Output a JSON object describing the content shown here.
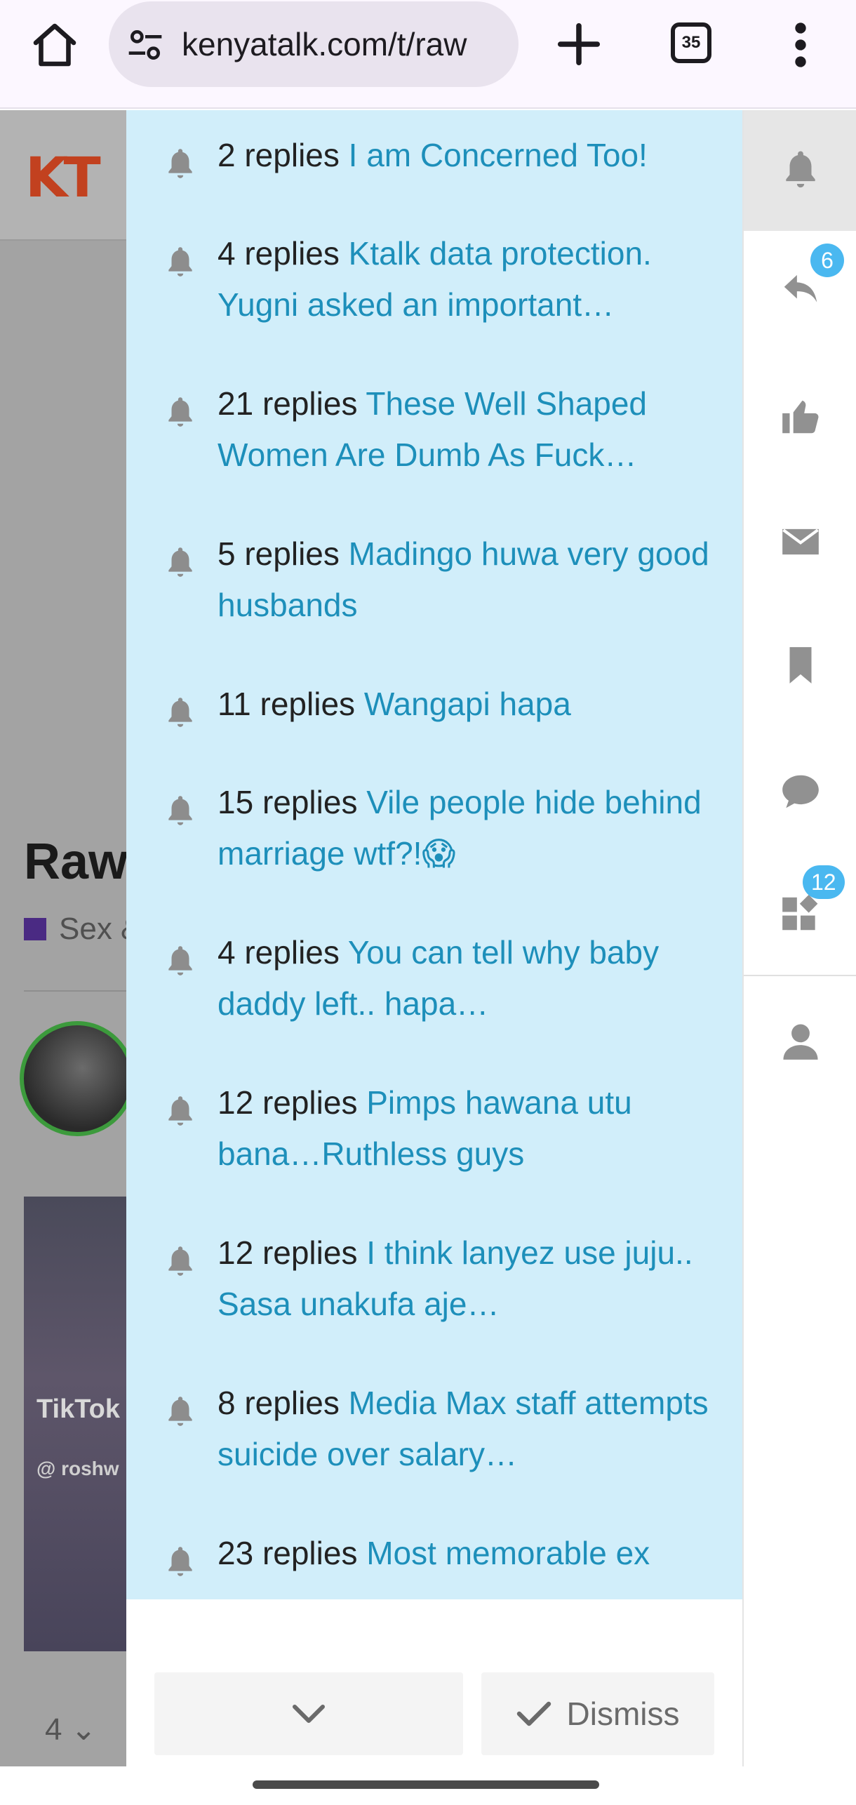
{
  "browser": {
    "url": "kenyatalk.com/t/raw",
    "tab_count": "35"
  },
  "background_page": {
    "logo": "KT",
    "title": "Raw",
    "category": "Sex &",
    "tiktok_watermark": "TikTok",
    "tiktok_handle": "@ roshw",
    "pager_value": "4"
  },
  "side_panel": {
    "replies_badge": "6",
    "review_badge": "12"
  },
  "notifications": [
    {
      "count": "2 replies",
      "topic": "I am Concerned Too!"
    },
    {
      "count": "4 replies",
      "topic": "Ktalk data protection. Yugni asked an important…"
    },
    {
      "count": "21 replies",
      "topic": "These Well Shaped Women Are Dumb As Fuck…"
    },
    {
      "count": "5 replies",
      "topic": "Madingo huwa very good husbands"
    },
    {
      "count": "11 replies",
      "topic": "Wangapi hapa"
    },
    {
      "count": "15 replies",
      "topic": "Vile people hide behind marriage wtf?!😱"
    },
    {
      "count": "4 replies",
      "topic": "You can tell why baby daddy left.. hapa…"
    },
    {
      "count": "12 replies",
      "topic": "Pimps hawana utu bana…Ruthless guys"
    },
    {
      "count": "12 replies",
      "topic": "I think lanyez use juju.. Sasa unakufa aje…"
    },
    {
      "count": "8 replies",
      "topic": "Media Max staff attempts suicide over salary…"
    },
    {
      "count": "23 replies",
      "topic": "Most memorable ex"
    }
  ],
  "footer": {
    "dismiss_label": "Dismiss"
  },
  "colors": {
    "notification_bg": "#d1eefa",
    "topic_link": "#1d8fba",
    "badge": "#4ab8f0"
  }
}
